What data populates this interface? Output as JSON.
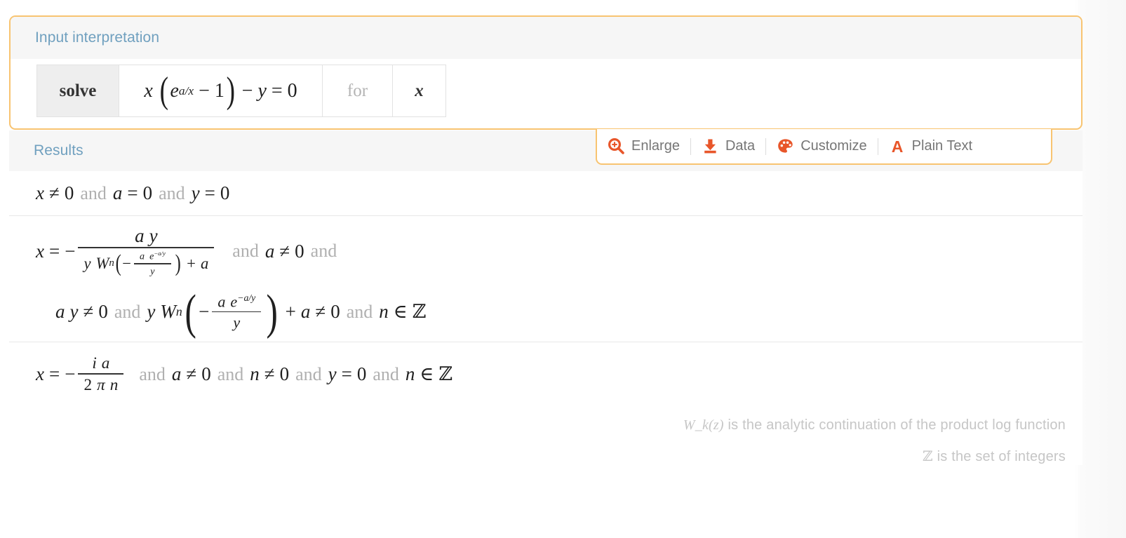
{
  "accent_color": "#f8c471",
  "header_text_color": "#70a0bf",
  "icon_color": "#e8562a",
  "pods": {
    "input": {
      "title": "Input interpretation",
      "cells": {
        "solve_label": "solve",
        "equation": "x (e^(a/x) - 1) - y = 0",
        "for_label": "for",
        "variable": "x"
      }
    },
    "results": {
      "title": "Results"
    }
  },
  "toolbar": {
    "items": [
      {
        "label": "Enlarge",
        "icon": "magnifier-plus-icon"
      },
      {
        "label": "Data",
        "icon": "download-icon"
      },
      {
        "label": "Customize",
        "icon": "palette-icon"
      },
      {
        "label": "Plain Text",
        "icon": "letter-a-icon"
      }
    ]
  },
  "equation_parts": {
    "x": "x",
    "a": "a",
    "y": "y",
    "n": "n",
    "i": "i",
    "e": "e",
    "W": "W",
    "pi": "π",
    "zero": "0",
    "two": "2",
    "one": "1",
    "eq": "=",
    "neq": "≠",
    "minus": "−",
    "plus": "+",
    "in": "∈",
    "integers": "ℤ",
    "and": "and",
    "a_over_x": "a/x",
    "neg_a_over_y": "−a/y",
    "lparen": "(",
    "rparen": ")"
  },
  "results": [
    {
      "id": "result-1",
      "plain": "x ≠ 0 and a = 0 and y = 0",
      "conditions": [
        "x ≠ 0",
        "a = 0",
        "y = 0"
      ]
    },
    {
      "id": "result-2",
      "plain": "x = -(a y)/(y W_n(-(a e^(-a/y))/y) + a) and a ≠ 0 and a y ≠ 0 and y W_n(-(a e^(-a/y))/y) + a ≠ 0 and n ∈ ℤ",
      "conditions": [
        "a ≠ 0",
        "a y ≠ 0",
        "y W_n(-(a e^(-a/y))/y) + a ≠ 0",
        "n ∈ ℤ"
      ]
    },
    {
      "id": "result-3",
      "plain": "x = -(i a)/(2 π n) and a ≠ 0 and n ≠ 0 and y = 0 and n ∈ ℤ",
      "conditions": [
        "a ≠ 0",
        "n ≠ 0",
        "y = 0",
        "n ∈ ℤ"
      ]
    }
  ],
  "footnotes": [
    {
      "symbol": "W_k(z)",
      "text": " is the analytic continuation of the product log function"
    },
    {
      "symbol": "ℤ",
      "text": " is the set of integers"
    }
  ]
}
